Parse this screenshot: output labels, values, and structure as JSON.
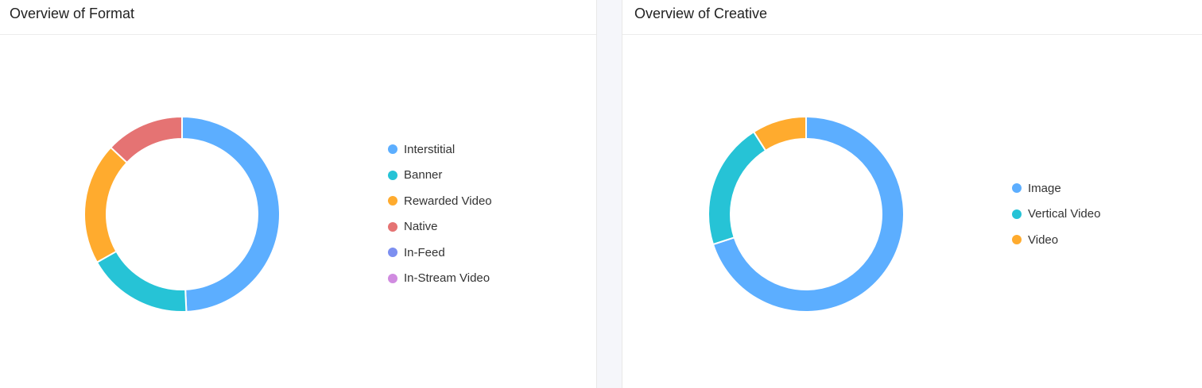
{
  "panels": {
    "format": {
      "title": "Overview of Format"
    },
    "creative": {
      "title": "Overview of Creative"
    }
  },
  "chart_data": [
    {
      "type": "pie",
      "title": "Overview of Format",
      "donut": true,
      "legend_position": "right",
      "categories": [
        "Interstitial",
        "Banner",
        "Rewarded Video",
        "Native",
        "In-Feed",
        "In-Stream Video"
      ],
      "values": [
        49.3,
        17.5,
        20.2,
        13.0,
        0,
        0
      ],
      "colors": [
        "#5caeff",
        "#26c3d6",
        "#ffab2e",
        "#e57373",
        "#7c8ff0",
        "#d08be0"
      ]
    },
    {
      "type": "pie",
      "title": "Overview of Creative",
      "donut": true,
      "legend_position": "right",
      "categories": [
        "Image",
        "Vertical Video",
        "Video"
      ],
      "values": [
        70.0,
        21.0,
        9.0
      ],
      "colors": [
        "#5caeff",
        "#26c3d6",
        "#ffab2e"
      ]
    }
  ]
}
